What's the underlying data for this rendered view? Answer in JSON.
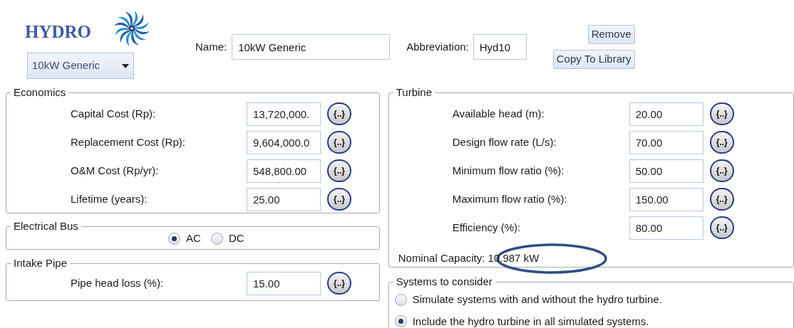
{
  "header": {
    "title": "HYDRO",
    "preset": "10kW Generic",
    "name": {
      "label": "Name:",
      "value": "10kW Generic"
    },
    "abbreviation": {
      "label": "Abbreviation:",
      "value": "Hyd10"
    },
    "buttons": [
      "Remove",
      "Copy To Library"
    ]
  },
  "economics": {
    "title": "Economics",
    "fields": [
      {
        "label": "Capital Cost (Rp):",
        "value": "13,720,000.",
        "button": "{..}"
      },
      {
        "label": "Replacement Cost (Rp):",
        "value": "9,604,000.0",
        "button": "{..}"
      },
      {
        "label": "O&M Cost (Rp/yr):",
        "value": "548,800.00",
        "button": "{..}"
      },
      {
        "label": "Lifetime (years):",
        "value": "25.00",
        "button": "{..}"
      }
    ]
  },
  "electrical_bus": {
    "title": "Electrical Bus",
    "options": [
      {
        "label": "AC",
        "selected": true
      },
      {
        "label": "DC",
        "selected": false
      }
    ]
  },
  "intake_pipe": {
    "title": "Intake Pipe",
    "fields": [
      {
        "label": "Pipe head loss (%):",
        "value": "15.00",
        "button": "{..}"
      }
    ]
  },
  "turbine": {
    "title": "Turbine",
    "fields": [
      {
        "label": "Available head (m):",
        "value": "20.00",
        "button": "{..}"
      },
      {
        "label": "Design flow rate (L/s):",
        "value": "70.00",
        "button": "{..}"
      },
      {
        "label": "Minimum flow ratio (%):",
        "value": "50.00",
        "button": "{..}"
      },
      {
        "label": "Maximum flow ratio (%):",
        "value": "150.00",
        "button": "{..}"
      },
      {
        "label": "Efficiency (%):",
        "value": "80.00",
        "button": "{..}"
      }
    ],
    "nominal_capacity": "Nominal Capacity: 10.987 kW"
  },
  "systems_to_consider": {
    "title": "Systems to consider",
    "options": [
      {
        "label": "Simulate systems with and without the hydro turbine.",
        "selected": false
      },
      {
        "label": "Include the hydro turbine in all simulated systems.",
        "selected": true
      }
    ]
  }
}
